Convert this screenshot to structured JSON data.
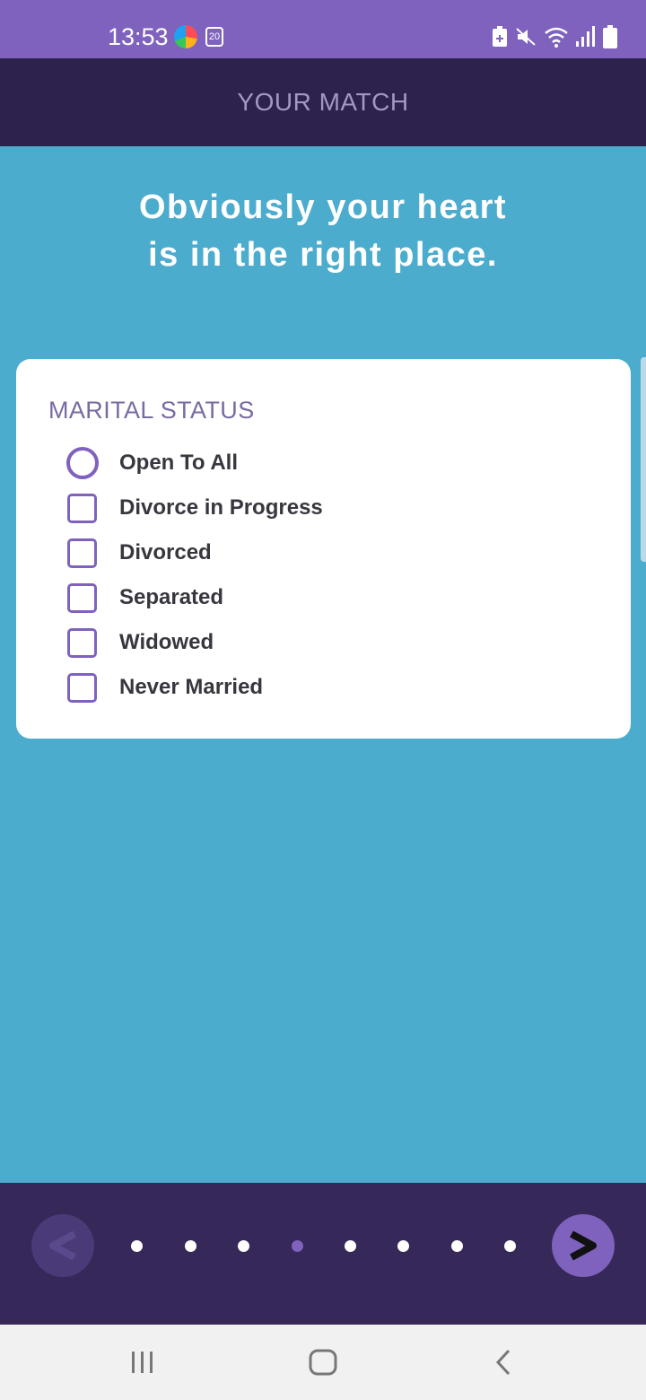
{
  "status_bar": {
    "time": "13:53",
    "calendar_badge": "20",
    "icons": [
      "browser-app-icon",
      "calendar-icon",
      "battery-saver-icon",
      "mute-icon",
      "wifi-icon",
      "signal-icon",
      "battery-icon"
    ]
  },
  "header": {
    "title": "YOUR MATCH"
  },
  "headline": {
    "line1": "Obviously your heart",
    "line2": "is in the right place."
  },
  "marital_status": {
    "label": "MARITAL STATUS",
    "options": [
      {
        "label": "Open To All",
        "type": "radio",
        "selected": false
      },
      {
        "label": "Divorce in Progress",
        "type": "checkbox",
        "checked": false
      },
      {
        "label": "Divorced",
        "type": "checkbox",
        "checked": false
      },
      {
        "label": "Separated",
        "type": "checkbox",
        "checked": false
      },
      {
        "label": "Widowed",
        "type": "checkbox",
        "checked": false
      },
      {
        "label": "Never Married",
        "type": "checkbox",
        "checked": false
      }
    ]
  },
  "pager": {
    "prev_icon": "chevron-left-icon",
    "next_icon": "chevron-right-icon",
    "total_pages": 8,
    "current_page": 4
  },
  "colors": {
    "accent": "#7e62bd",
    "background": "#4bacce",
    "header": "#2d214d",
    "bottom_bar": "#362858"
  }
}
